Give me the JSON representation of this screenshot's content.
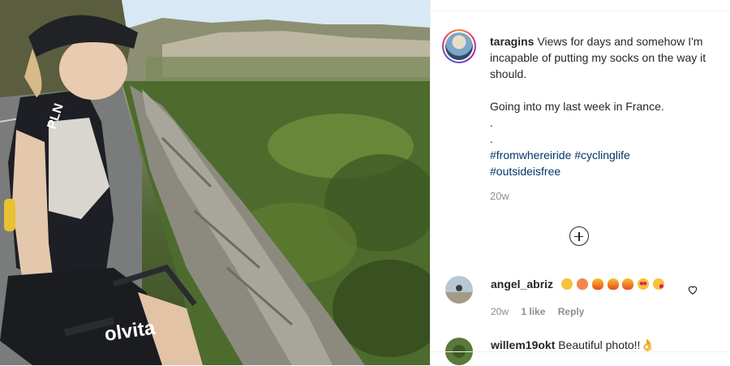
{
  "post": {
    "username": "taragins",
    "caption_lines": [
      "Views for days and somehow I'm incapable of putting my socks on the way it should.",
      "",
      "Going into my last week in France.",
      ".",
      "."
    ],
    "hashtags": [
      "#fromwhereiride",
      "#cyclinglife",
      "#outsideisfree"
    ],
    "timestamp": "20w"
  },
  "photo": {
    "jersey_brand": "PLN",
    "shorts_text": "olvita"
  },
  "comments": [
    {
      "username": "angel_abriz",
      "emojis": [
        "astonished-face",
        "peach",
        "fire",
        "fire",
        "fire",
        "heart-eyes",
        "kissing-heart"
      ],
      "timestamp": "20w",
      "likes": "1 like",
      "reply_label": "Reply"
    },
    {
      "username": "willem19okt",
      "text": "Beautiful photo!!👌"
    }
  ],
  "colors": {
    "hashtag": "#00376b",
    "secondary_text": "#8e8e8e",
    "primary_text": "#262626"
  }
}
